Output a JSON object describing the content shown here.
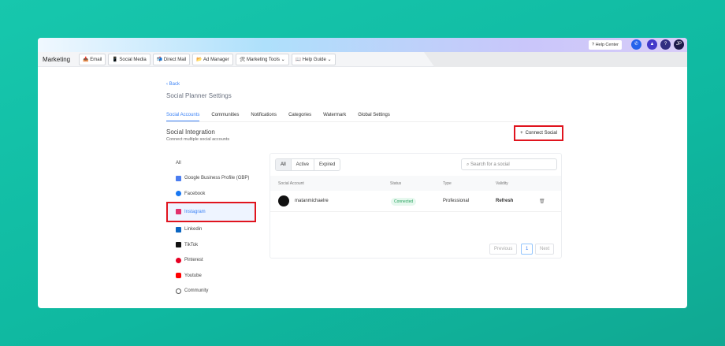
{
  "topbar": {
    "help_center": "? Help Center",
    "avatar_initials": "JP",
    "help_icon": "?"
  },
  "nav": {
    "title": "Marketing",
    "items": [
      "📥 Email",
      "📱 Social Media",
      "📬 Direct Mail",
      "📂 Ad Manager",
      "🛠 Marketing Tools ⌄",
      "📖 Help Guide ⌄"
    ]
  },
  "page": {
    "back": "‹ Back",
    "title": "Social Planner Settings"
  },
  "tabs": [
    "Social Accounts",
    "Communities",
    "Notifications",
    "Categories",
    "Watermark",
    "Global Settings"
  ],
  "section": {
    "heading": "Social Integration",
    "subheading": "Connect multiple social accounts",
    "connect": "Connect Social",
    "connect_icon": "+"
  },
  "sidebar": [
    {
      "label": "All",
      "color": ""
    },
    {
      "label": "Google Business Profile (GBP)",
      "color": "#4a7df0"
    },
    {
      "label": "Facebook",
      "color": "#1877f2"
    },
    {
      "label": "Instagram",
      "color": "#e1306c"
    },
    {
      "label": "Linkedin",
      "color": "#0a66c2"
    },
    {
      "label": "TikTok",
      "color": "#111111"
    },
    {
      "label": "Pinterest",
      "color": "#e60023"
    },
    {
      "label": "Youtube",
      "color": "#ff0000"
    },
    {
      "label": "Community",
      "color": "#555555"
    }
  ],
  "filters": [
    "All",
    "Active",
    "Expired"
  ],
  "search": {
    "placeholder": "Search for a social"
  },
  "table": {
    "headers": [
      "Social Account",
      "Status",
      "Type",
      "Validity"
    ],
    "rows": [
      {
        "account": "matanmichaelre",
        "status": "Connected",
        "type": "Professional",
        "validity": "Refresh"
      }
    ]
  },
  "pagination": {
    "previous": "Previous",
    "page": "1",
    "next": "Next"
  }
}
